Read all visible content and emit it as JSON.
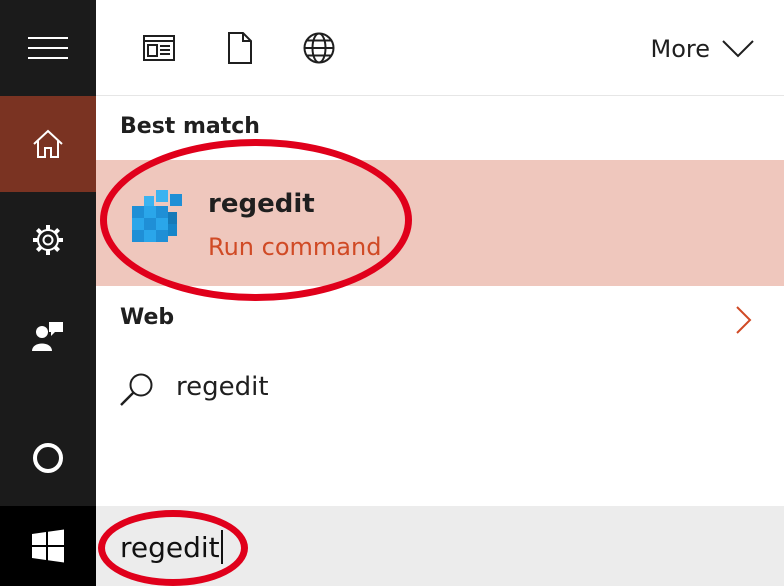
{
  "colors": {
    "rail_bg": "#1b1b1b",
    "rail_active": "#7a3322",
    "start_bg": "#000000",
    "result_highlight": "#efc7bd",
    "accent_orange": "#d04a25",
    "annotation_red": "#e0001b",
    "searchbar_bg": "#ececec"
  },
  "sidebar": {
    "items": [
      {
        "name": "hamburger-icon",
        "icon": "hamburger"
      },
      {
        "name": "home-icon",
        "icon": "home",
        "active": true
      },
      {
        "name": "settings-gear-icon",
        "icon": "gear"
      },
      {
        "name": "feedback-icon",
        "icon": "person-speech"
      },
      {
        "name": "cortana-circle-icon",
        "icon": "circle"
      },
      {
        "name": "windows-start-icon",
        "icon": "windows-logo"
      }
    ]
  },
  "filters": {
    "icons": [
      "apps-icon",
      "documents-icon",
      "web-icon"
    ],
    "more_label": "More"
  },
  "best_match": {
    "label": "Best match",
    "title": "regedit",
    "subtitle": "Run command",
    "icon": "registry-editor-icon"
  },
  "web": {
    "label": "Web",
    "suggestion": "regedit"
  },
  "search": {
    "value": "regedit"
  }
}
